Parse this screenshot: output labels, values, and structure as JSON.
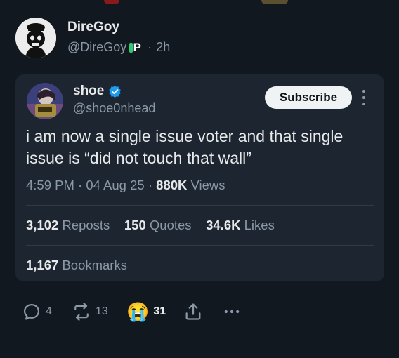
{
  "post": {
    "author_name": "DireGoy",
    "author_handle": "@DireGoy",
    "badge_letter": "P",
    "separator": "·",
    "time_ago": "2h"
  },
  "quote": {
    "author_name": "shoe",
    "author_handle": "@shoe0nhead",
    "subscribe_label": "Subscribe",
    "text": "i am now a single issue voter and that single issue is “did not touch that wall”",
    "time": "4:59 PM",
    "sep1": "·",
    "date": "04 Aug 25",
    "sep2": "·",
    "views_count": "880K",
    "views_label": "Views",
    "reposts_count": "3,102",
    "reposts_label": "Reposts",
    "quotes_count": "150",
    "quotes_label": "Quotes",
    "likes_count": "34.6K",
    "likes_label": "Likes",
    "bookmarks_count": "1,167",
    "bookmarks_label": "Bookmarks"
  },
  "actions": {
    "replies": "4",
    "reposts": "13",
    "reaction_emoji": "😭",
    "reactions": "31"
  },
  "colors": {
    "background": "#121820",
    "card": "#1c2530",
    "text_primary": "#e7e9ea",
    "text_secondary": "#8b98a5",
    "verified_blue": "#1d9bf0"
  }
}
